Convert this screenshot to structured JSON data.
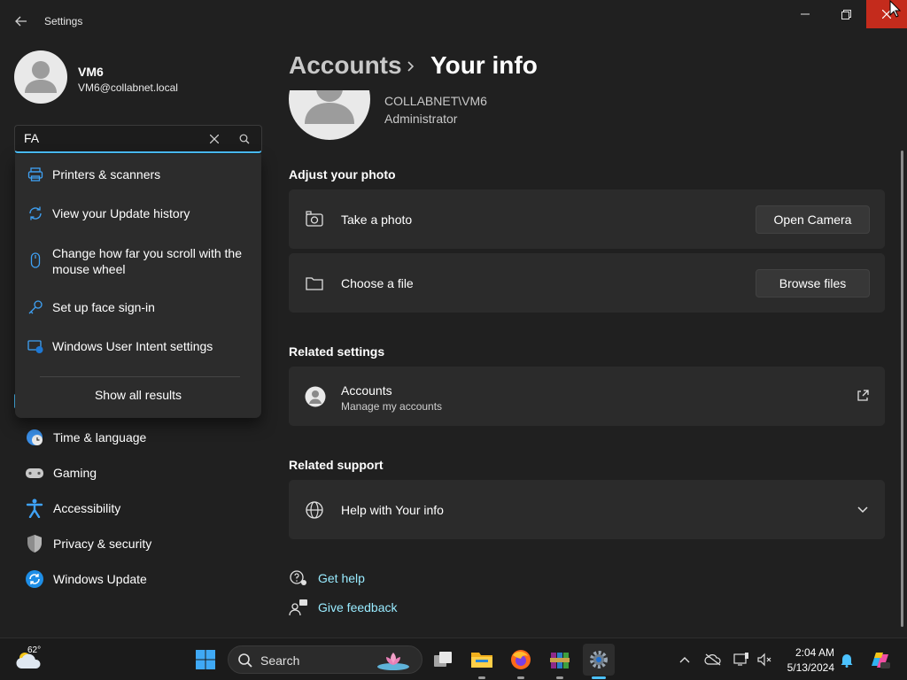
{
  "window": {
    "app_title": "Settings"
  },
  "profile": {
    "name": "VM6",
    "email": "VM6@collabnet.local"
  },
  "search": {
    "value": "FA",
    "results": [
      {
        "label": "Printers & scanners",
        "icon": "printer-icon"
      },
      {
        "label": "View your Update history",
        "icon": "sync-icon"
      },
      {
        "label": "Change how far you scroll with the mouse wheel",
        "icon": "mouse-icon"
      },
      {
        "label": "Set up face sign-in",
        "icon": "key-icon"
      },
      {
        "label": "Windows User Intent settings",
        "icon": "monitor-shield-icon"
      }
    ],
    "show_all_label": "Show all results"
  },
  "nav": {
    "items": [
      {
        "label": "Time & language",
        "icon": "globe-clock-icon"
      },
      {
        "label": "Gaming",
        "icon": "gamepad-icon"
      },
      {
        "label": "Accessibility",
        "icon": "accessibility-icon"
      },
      {
        "label": "Privacy & security",
        "icon": "shield-icon"
      },
      {
        "label": "Windows Update",
        "icon": "update-icon"
      }
    ]
  },
  "main": {
    "breadcrumb_parent": "Accounts",
    "breadcrumb_current": "Your info",
    "account_domain": "COLLABNET\\VM6",
    "account_role": "Administrator",
    "adjust_photo_title": "Adjust your photo",
    "take_photo_label": "Take a photo",
    "open_camera_label": "Open Camera",
    "choose_file_label": "Choose a file",
    "browse_files_label": "Browse files",
    "related_settings_title": "Related settings",
    "accounts_label": "Accounts",
    "accounts_sub": "Manage my accounts",
    "related_support_title": "Related support",
    "help_label": "Help with Your info",
    "get_help_label": "Get help",
    "give_feedback_label": "Give feedback"
  },
  "taskbar": {
    "temperature": "62°",
    "search_label": "Search",
    "time": "2:04 AM",
    "date": "5/13/2024"
  },
  "colors": {
    "accent": "#4cc2ff",
    "link": "#99ebff",
    "close_button": "#c42b1c",
    "background": "#202020",
    "card": "#2b2b2b"
  }
}
